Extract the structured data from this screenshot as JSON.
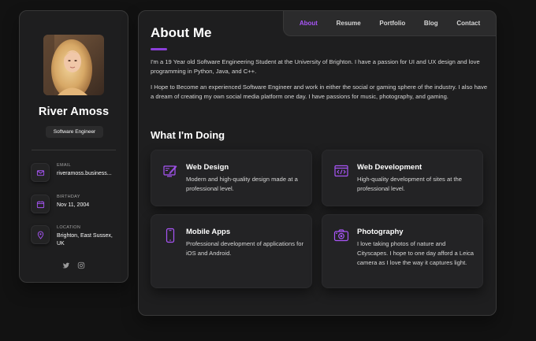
{
  "profile": {
    "name": "River Amoss",
    "title": "Software Engineer"
  },
  "contacts": [
    {
      "label": "Email",
      "value": "riveramoss.business..."
    },
    {
      "label": "Birthday",
      "value": "Nov 11, 2004"
    },
    {
      "label": "Location",
      "value": "Brighton, East Sussex, UK"
    }
  ],
  "social": [
    "twitter-icon",
    "instagram-icon"
  ],
  "nav": {
    "items": [
      "About",
      "Resume",
      "Portfolio",
      "Blog",
      "Contact"
    ],
    "active": "About"
  },
  "about": {
    "heading": "About Me",
    "paragraphs": [
      "I'm a 19 Year old Software Engineering Student at the University of Brighton. I have a passion for UI and UX design and love programming in Python, Java, and C++.",
      "I Hope to Become an experienced Software Engineer and work in either the social or gaming sphere of the industry. I also have a dream of creating my own social media platform one day. I have passions for music, photography, and gaming."
    ]
  },
  "services": {
    "heading": "What I'm Doing",
    "items": [
      {
        "title": "Web Design",
        "text": "Modern and high-quality design made at a professional level.",
        "icon": "web-design-icon"
      },
      {
        "title": "Web Development",
        "text": "High-quality development of sites at the professional level.",
        "icon": "web-development-icon"
      },
      {
        "title": "Mobile Apps",
        "text": "Professional development of applications for iOS and Android.",
        "icon": "mobile-icon"
      },
      {
        "title": "Photography",
        "text": "I love taking photos of nature and Cityscapes. I hope to one day afford a Leica camera as I love the way it captures light.",
        "icon": "camera-icon"
      }
    ]
  },
  "colors": {
    "accent": "#a855f7",
    "background": "#121212",
    "card": "#1e1e1f"
  }
}
